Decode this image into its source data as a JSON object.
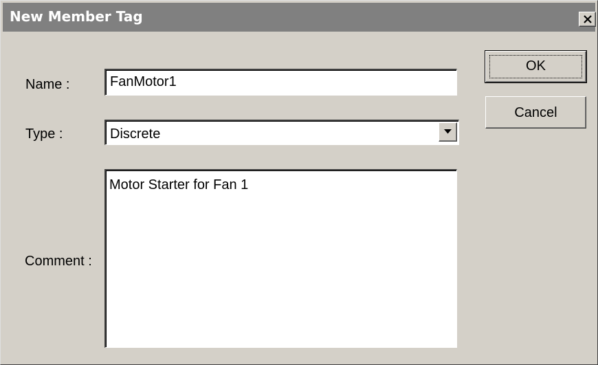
{
  "dialog": {
    "title": "New Member Tag",
    "close_symbol": "✕"
  },
  "form": {
    "name_label": "Name :",
    "name_value": "FanMotor1",
    "type_label": "Type :",
    "type_value": "Discrete",
    "comment_label": "Comment :",
    "comment_value": "Motor Starter for Fan 1"
  },
  "buttons": {
    "ok_label": "OK",
    "cancel_label": "Cancel"
  },
  "icons": {
    "close": "close-icon",
    "dropdown": "chevron-down-icon"
  },
  "colors": {
    "face": "#d4d0c8",
    "titlebar_inactive": "#808080",
    "field_bg": "#ffffff"
  }
}
